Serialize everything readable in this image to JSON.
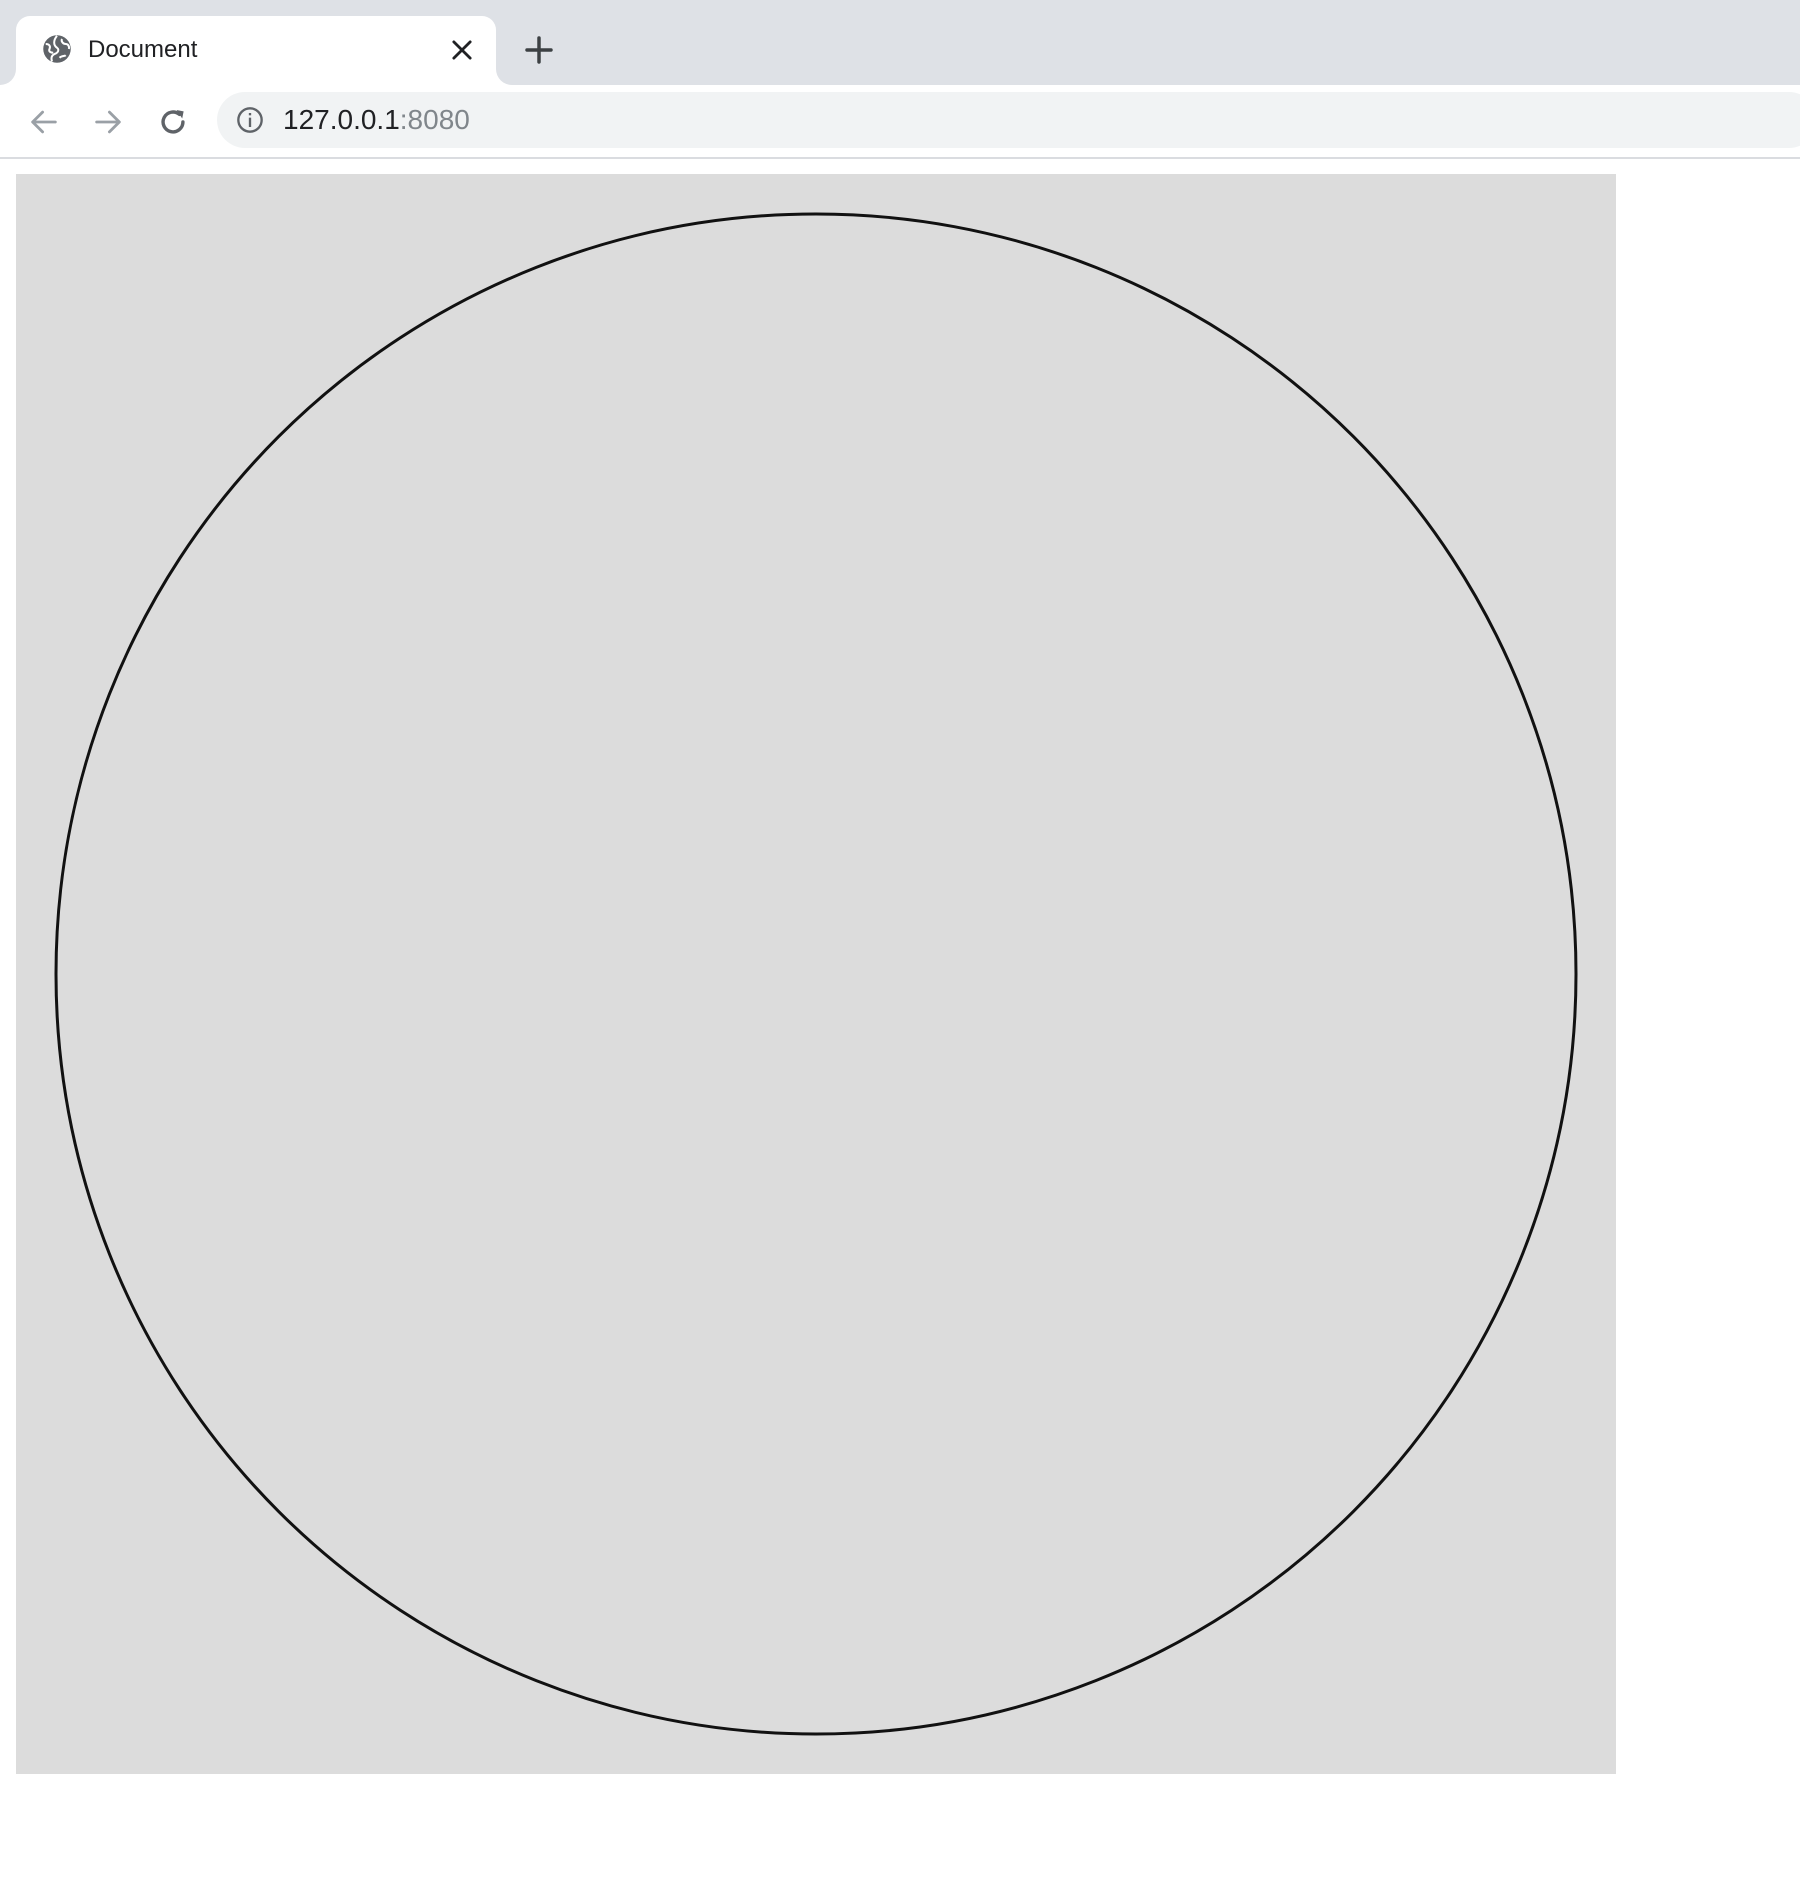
{
  "browser": {
    "tab": {
      "title": "Document",
      "favicon_icon": "globe-icon",
      "close_icon": "close-icon"
    },
    "new_tab_icon": "plus-icon",
    "toolbar": {
      "back_icon": "arrow-left-icon",
      "forward_icon": "arrow-right-icon",
      "reload_icon": "reload-icon"
    },
    "address_bar": {
      "info_icon": "info-icon",
      "host": "127.0.0.1",
      "port": ":8080"
    }
  },
  "page": {
    "canvas": {
      "background": "#dcdcdc",
      "shape": "circle",
      "stroke": "#111111",
      "fill": "none"
    }
  },
  "colors": {
    "tab_strip": "#dee1e6",
    "omnibox": "#f1f3f4",
    "icon": "#5f6368",
    "disabled_icon": "#9aa0a6"
  }
}
